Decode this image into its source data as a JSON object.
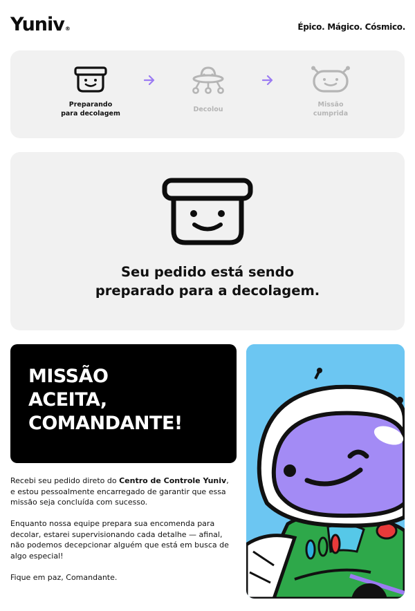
{
  "header": {
    "logo_text": "Yuniv",
    "logo_mark": "®",
    "tagline": "Épico. Mágico. Cósmico."
  },
  "progress": {
    "steps": [
      {
        "label": "Preparando\npara decolagem",
        "icon": "box-face-icon",
        "state": "active"
      },
      {
        "label": "Decolou",
        "icon": "ufo-icon",
        "state": "inactive"
      },
      {
        "label": "Missão\ncumprida",
        "icon": "alien-face-icon",
        "state": "inactive"
      }
    ],
    "arrow_icon": "arrow-right-icon",
    "arrow_color": "#9b7bf2",
    "inactive_color": "#b5b5b5"
  },
  "status": {
    "icon": "box-face-icon",
    "line1": "Seu pedido está sendo",
    "line2": "preparado para a decolagem."
  },
  "mission": {
    "title_lines": [
      "MISSÃO",
      "ACEITA,",
      "COMANDANTE!"
    ]
  },
  "message": {
    "p1_before": "Recebi seu pedido direto do ",
    "p1_strong": "Centro de Controle Yuniv",
    "p1_after": ", e estou pessoalmente encarregado de garantir que essa missão seja concluída com sucesso.",
    "p2": "Enquanto nossa equipe prepara sua encomenda para decolar, estarei supervisionando cada detalhe — afinal, não podemos decepcionar alguém que está em busca de algo especial!",
    "p3": "Fique em paz, Comandante."
  },
  "illustration": {
    "icon": "astronaut-character-icon",
    "colors": {
      "sky": "#6cc6f2",
      "face": "#a38bf5",
      "suit": "#2ea84a",
      "helmet": "#ffffff"
    }
  }
}
